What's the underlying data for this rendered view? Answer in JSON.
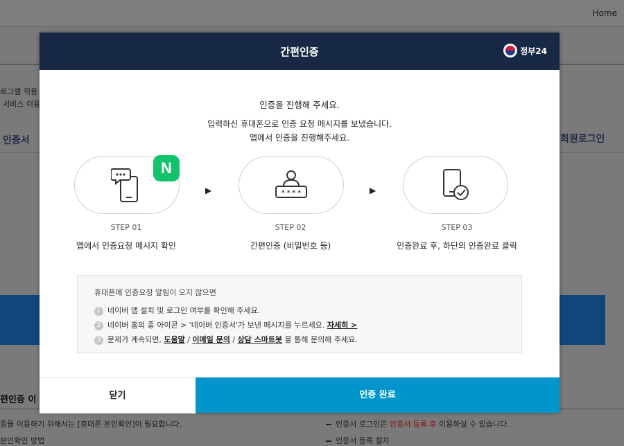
{
  "background": {
    "home_link": "Home",
    "left_line1": "로그램 적용",
    "left_line2": "서비스 이용",
    "tab_left": "인증서",
    "tab_right": "회원로그인",
    "section_title": "편인증 이",
    "bottom_left1": "증을 이용하기 위해서는 [휴대폰 본인확인]이 필요합니다.",
    "bottom_left2": "본인확인 방법",
    "bottom_right1_pre": "인증서 로그인은 ",
    "bottom_right1_red": "인증서 등록 후",
    "bottom_right1_post": " 이용하실 수 있습니다.",
    "bottom_right2": "인증서 등록 절차"
  },
  "modal": {
    "title": "간편인증",
    "logo_text": "정부24",
    "intro_line1": "인증을 진행해 주세요.",
    "intro_line2": "입력하신 휴대폰으로 인증 요청 메시지를 보냈습니다.",
    "intro_line3": "앱에서 인증을 진행해주세요.",
    "badge": "N",
    "arrow": "▶",
    "steps": [
      {
        "no": "STEP 01",
        "desc": "앱에서 인증요청 메시지 확인",
        "icon": "phone-message-icon"
      },
      {
        "no": "STEP 02",
        "desc": "간편인증 (비밀번호 등)",
        "icon": "user-password-icon"
      },
      {
        "no": "STEP 03",
        "desc": "인증완료 후, 하단의 인증완료 클릭",
        "icon": "phone-check-icon"
      }
    ],
    "notice": {
      "title": "휴대폰에 인증요청 알림이 오지 않으면",
      "item1_num": "1",
      "item1": "네이버 앱 설치 및 로그인 여부를 확인해 주세요.",
      "item2_num": "2",
      "item2_text": "네이버 홈의 종 아이콘 > '네이버 인증서'가 보낸 메시지를 누르세요. ",
      "item2_link": "자세히 >",
      "item3_num": "3",
      "item3_pre": "문제가 계속되면, ",
      "item3_link1": "도움말",
      "item3_sep1": " / ",
      "item3_link2": "이메일 문의",
      "item3_sep2": " / ",
      "item3_link3": "상담 스마트봇",
      "item3_post": " 을 통해 문의해 주세요."
    },
    "close_label": "닫기",
    "done_label": "인증 완료"
  }
}
